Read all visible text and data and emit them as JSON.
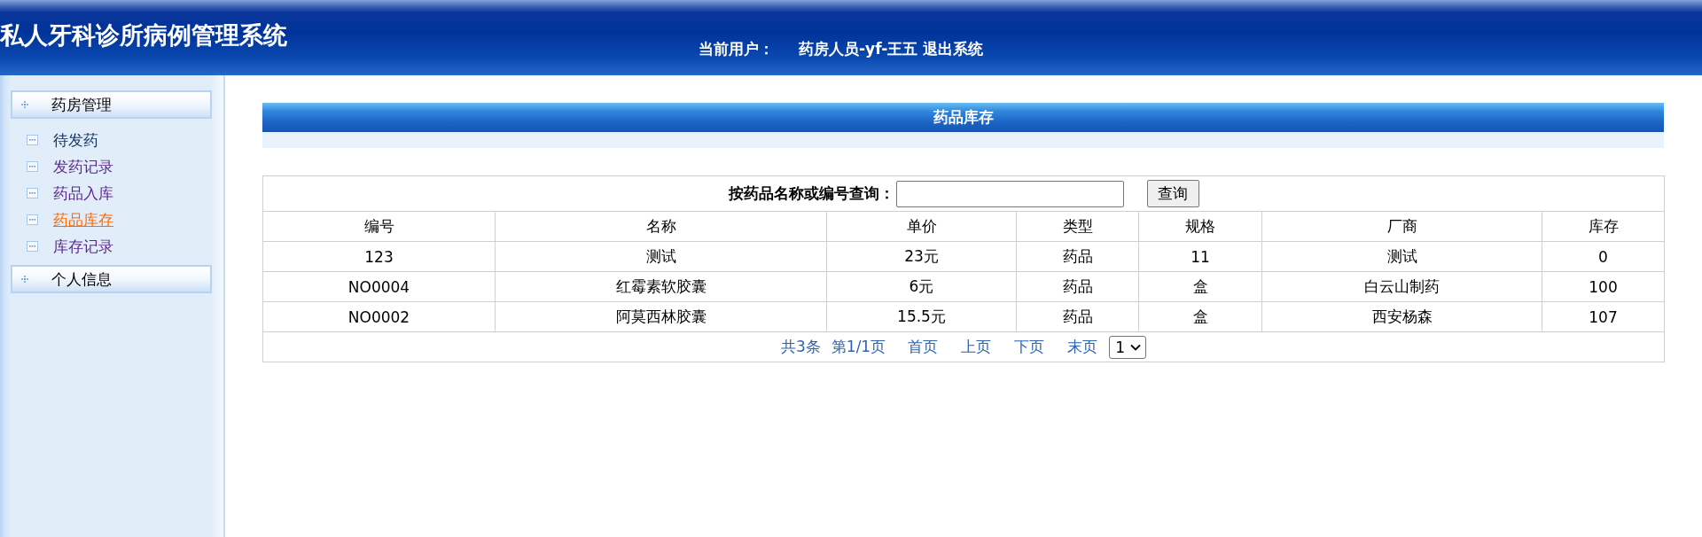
{
  "header": {
    "title": "私人牙科诊所病例管理系统",
    "user_label": "当前用户：",
    "user_name": "药房人员-yf-王五",
    "logout": "退出系统"
  },
  "sidebar": {
    "groups": [
      {
        "label": "药房管理",
        "items": [
          {
            "label": "待发药",
            "selected": false,
            "visited": false
          },
          {
            "label": "发药记录",
            "selected": false,
            "visited": true
          },
          {
            "label": "药品入库",
            "selected": false,
            "visited": true
          },
          {
            "label": "药品库存",
            "selected": true,
            "visited": true
          },
          {
            "label": "库存记录",
            "selected": false,
            "visited": true
          }
        ]
      },
      {
        "label": "个人信息"
      }
    ]
  },
  "panel": {
    "title": "药品库存"
  },
  "search": {
    "label": "按药品名称或编号查询：",
    "button": "查询"
  },
  "table": {
    "columns": [
      "编号",
      "名称",
      "单价",
      "类型",
      "规格",
      "厂商",
      "库存"
    ],
    "rows": [
      [
        "123",
        "测试",
        "23元",
        "药品",
        "11",
        "测试",
        "0"
      ],
      [
        "NO0004",
        "红霉素软胶囊",
        "6元",
        "药品",
        "盒",
        "白云山制药",
        "100"
      ],
      [
        "NO0002",
        "阿莫西林胶囊",
        "15.5元",
        "药品",
        "盒",
        "西安杨森",
        "107"
      ]
    ]
  },
  "pager": {
    "total": "共3条",
    "page_info": "第1/1页",
    "links": [
      "首页",
      "上页",
      "下页",
      "末页"
    ],
    "page_select": "1"
  }
}
